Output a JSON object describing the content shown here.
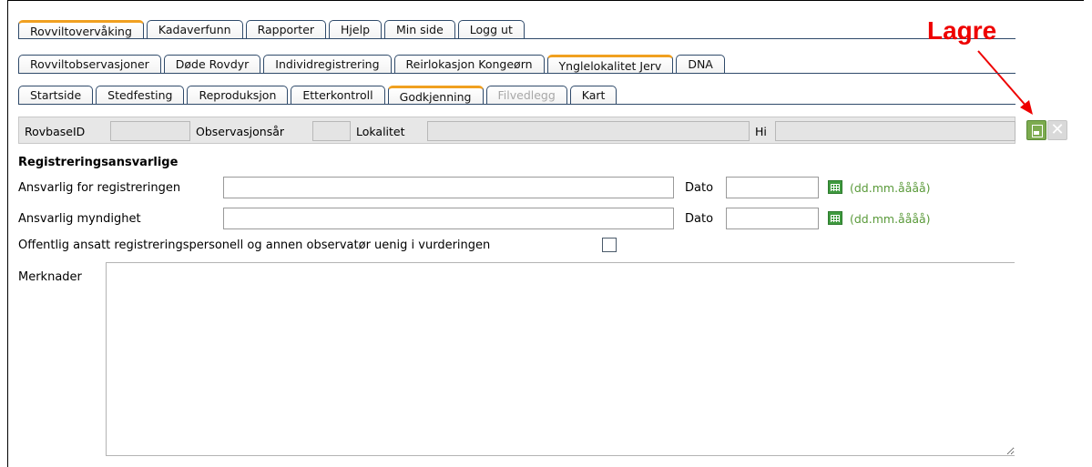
{
  "tabs_row1": [
    {
      "label": "Rovviltovervåking",
      "active": true
    },
    {
      "label": "Kadaverfunn"
    },
    {
      "label": "Rapporter"
    },
    {
      "label": "Hjelp"
    },
    {
      "label": "Min side"
    },
    {
      "label": "Logg ut"
    }
  ],
  "tabs_row2": [
    {
      "label": "Rovviltobservasjoner"
    },
    {
      "label": "Døde Rovdyr"
    },
    {
      "label": "Individregistrering"
    },
    {
      "label": "Reirlokasjon Kongeørn"
    },
    {
      "label": "Ynglelokalitet Jerv",
      "active": true
    },
    {
      "label": "DNA"
    }
  ],
  "tabs_row3": [
    {
      "label": "Startside"
    },
    {
      "label": "Stedfesting"
    },
    {
      "label": "Reproduksjon"
    },
    {
      "label": "Etterkontroll"
    },
    {
      "label": "Godkjenning",
      "active": true
    },
    {
      "label": "Filvedlegg",
      "disabled": true
    },
    {
      "label": "Kart"
    }
  ],
  "header": {
    "rovbaseid_label": "RovbaseID",
    "observasjonsar_label": "Observasjonsår",
    "lokalitet_label": "Lokalitet",
    "hi_label": "Hi"
  },
  "annotation": {
    "lagre": "Lagre"
  },
  "form": {
    "section_title": "Registreringsansvarlige",
    "responsible_label": "Ansvarlig for registreringen",
    "authority_label": "Ansvarlig myndighet",
    "dato_label": "Dato",
    "date_hint": "(dd.mm.åååå)",
    "disagree_label": "Offentlig ansatt registreringspersonell og annen observatør uenig i vurderingen",
    "merknader_label": "Merknader",
    "responsible_value": "",
    "authority_value": "",
    "dato1_value": "",
    "dato2_value": ""
  },
  "colors": {
    "accent_tab": "#f0a020",
    "save_green": "#7cab4f",
    "lagre_red": "#ee0000",
    "hint_green": "#5a9a3a"
  }
}
